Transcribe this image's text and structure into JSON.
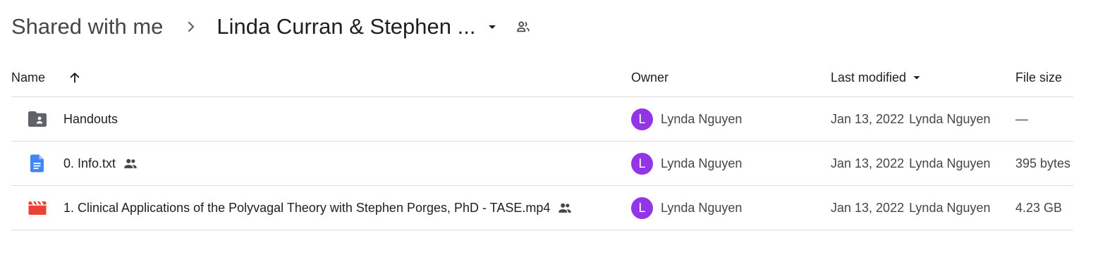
{
  "breadcrumb": {
    "root": "Shared with me",
    "current": "Linda Curran & Stephen ...",
    "separator_icon": "chevron-right-icon",
    "dropdown_icon": "arrow-drop-down-icon",
    "shared_icon": "people-icon"
  },
  "table": {
    "headers": {
      "name": "Name",
      "owner": "Owner",
      "modified": "Last modified",
      "size": "File size"
    },
    "sort": {
      "column": "name",
      "direction": "ascending",
      "icon": "arrow-up-icon"
    },
    "rows": [
      {
        "icon": "shared-folder-icon",
        "name": "Handouts",
        "shared": false,
        "owner_initial": "L",
        "owner": "Lynda Nguyen",
        "modified_date": "Jan 13, 2022",
        "modified_by": "Lynda Nguyen",
        "size": "—"
      },
      {
        "icon": "google-doc-icon",
        "name": "0. Info.txt",
        "shared": true,
        "owner_initial": "L",
        "owner": "Lynda Nguyen",
        "modified_date": "Jan 13, 2022",
        "modified_by": "Lynda Nguyen",
        "size": "395 bytes"
      },
      {
        "icon": "video-file-icon",
        "name": "1. Clinical Applications of the Polyvagal Theory with Stephen Porges, PhD - TASE.mp4",
        "shared": true,
        "owner_initial": "L",
        "owner": "Lynda Nguyen",
        "modified_date": "Jan 13, 2022",
        "modified_by": "Lynda Nguyen",
        "size": "4.23 GB"
      }
    ]
  },
  "colors": {
    "avatar": "#9334e6",
    "doc_icon": "#4285f4",
    "video_icon": "#ea4335",
    "folder_icon": "#5f6368",
    "divider": "#dadce0"
  }
}
